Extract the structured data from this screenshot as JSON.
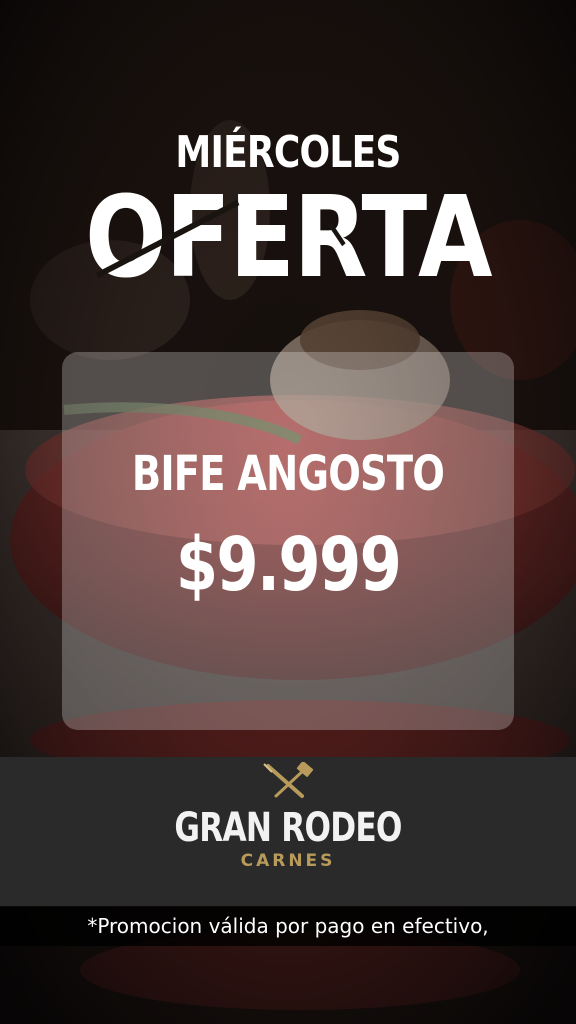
{
  "headline": {
    "day": "MIÉRCOLES",
    "offer": "OFERTA"
  },
  "product": {
    "name": "BIFE ANGOSTO",
    "price": "$9.999"
  },
  "brand": {
    "name": "GRAN RODEO",
    "subtitle": "CARNES",
    "logo_icon": "crossed-knife-cleaver-icon",
    "accent_color": "#b89a5a"
  },
  "footer": {
    "promo_note": "*Promocion válida por pago en efectivo,"
  },
  "colors": {
    "brand_bar": "#2a2a2a",
    "text": "#ffffff"
  }
}
